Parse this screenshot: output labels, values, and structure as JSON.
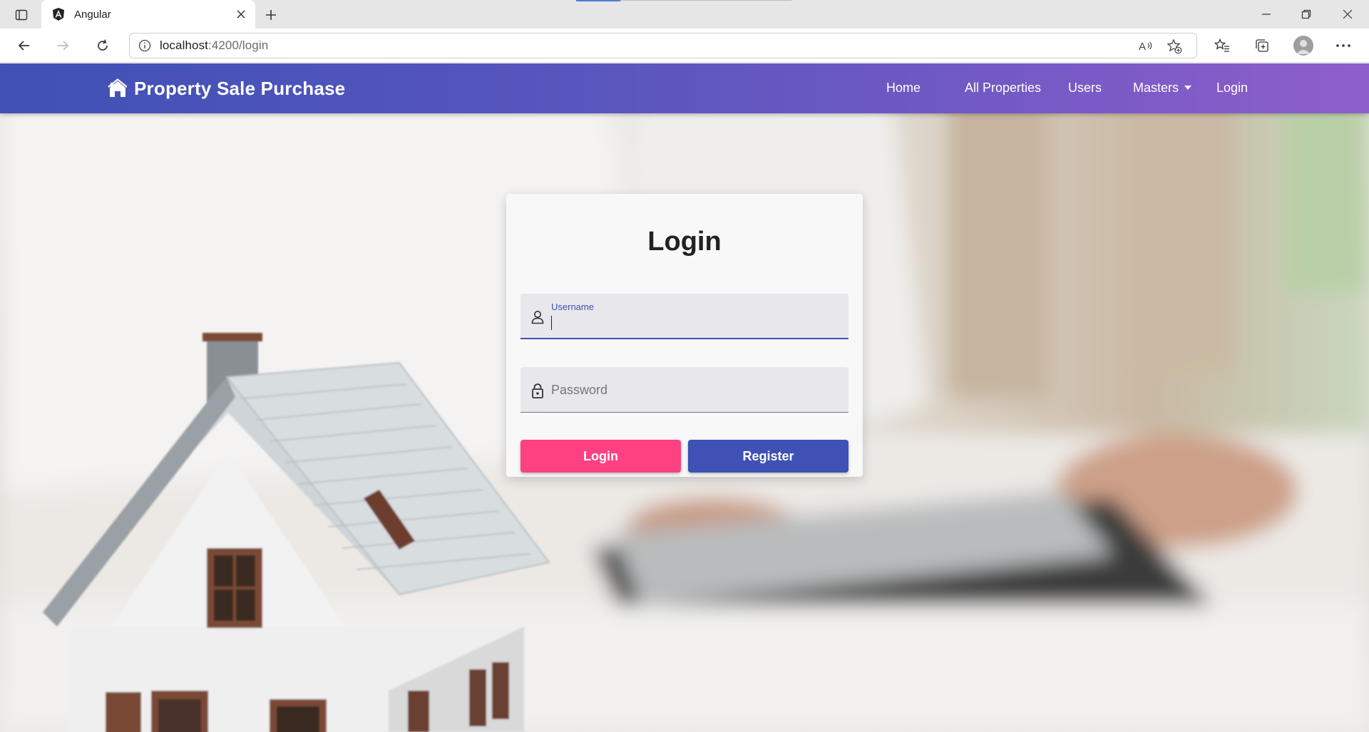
{
  "browser": {
    "tab_title": "Angular",
    "url_host": "localhost",
    "url_rest": ":4200/login"
  },
  "navbar": {
    "brand": "Property Sale Purchase",
    "links": [
      "Home",
      "All Properties",
      "Users",
      "Masters",
      "Login"
    ],
    "colors": {
      "start": "#3f51b5",
      "end": "#8e5fcb"
    }
  },
  "login": {
    "title": "Login",
    "username_label": "Username",
    "username_value": "",
    "password_placeholder": "Password",
    "login_button": "Login",
    "register_button": "Register",
    "colors": {
      "login_button": "#ff4081",
      "register_button": "#3f51b5"
    }
  },
  "icons": {
    "brand": "house-icon",
    "username": "person-icon",
    "password": "lock-icon"
  }
}
